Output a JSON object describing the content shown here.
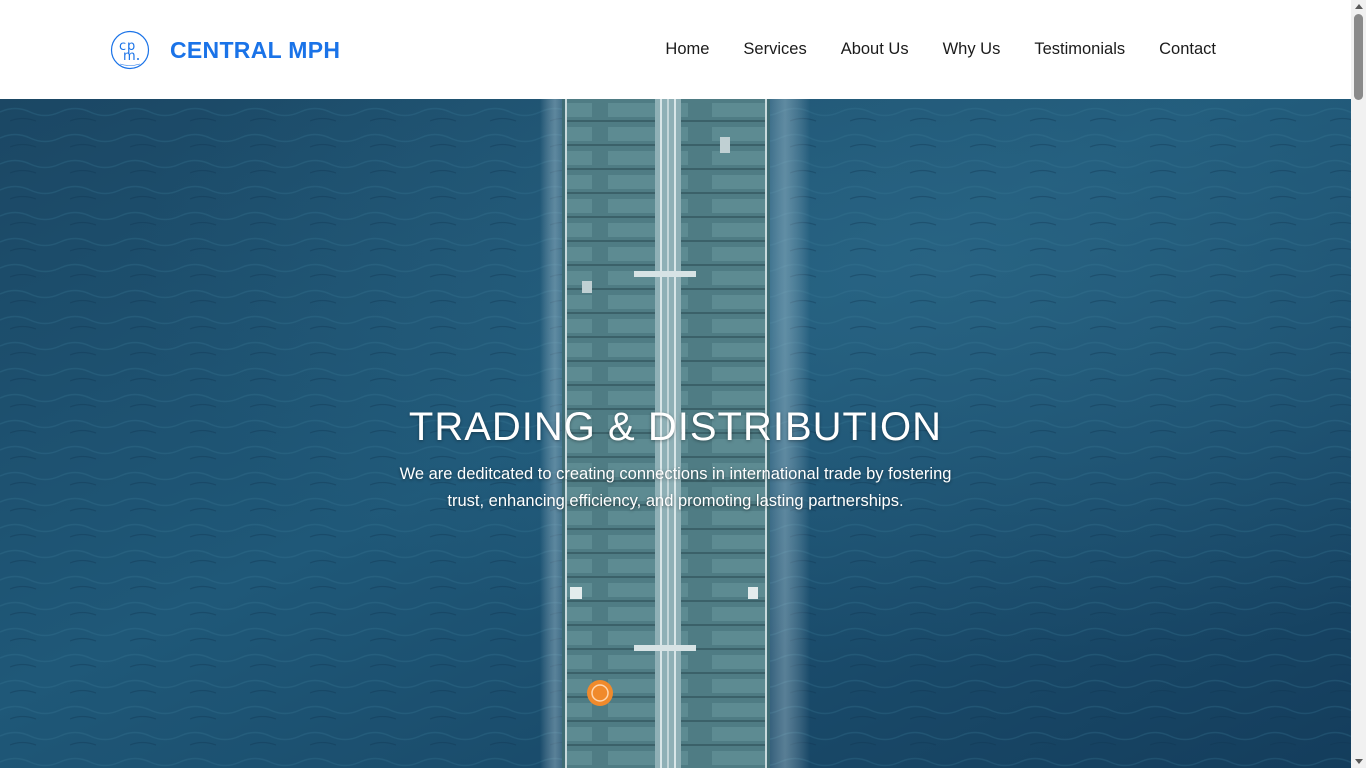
{
  "header": {
    "brand": "CENTRAL MPH",
    "logo_icon": "cpm-monogram-logo",
    "brand_color": "#1a73e8"
  },
  "nav": {
    "items": [
      {
        "label": "Home"
      },
      {
        "label": "Services"
      },
      {
        "label": "About Us"
      },
      {
        "label": "Why Us"
      },
      {
        "label": "Testimonials"
      },
      {
        "label": "Contact"
      }
    ]
  },
  "hero": {
    "title": "TRADING & DISTRIBUTION",
    "text": "We are deditcated to creating connections in international trade by fostering trust, enhancing efficiency, and promoting lasting partnerships.",
    "background": "aerial-tanker-ship-on-ocean",
    "ocean_color": "#1d4e6b"
  }
}
